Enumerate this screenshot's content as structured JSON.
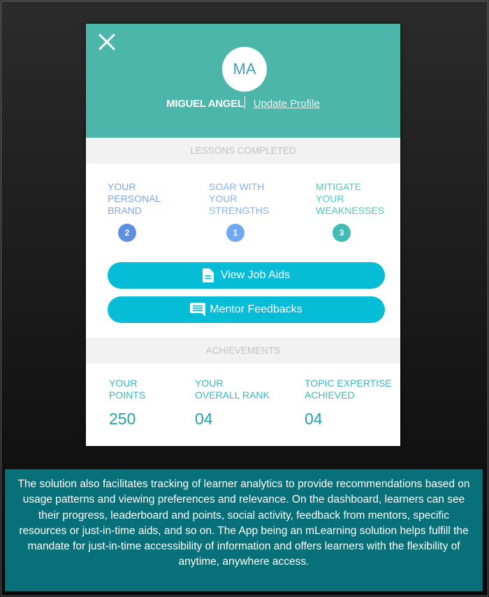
{
  "profile": {
    "initials": "MA",
    "name": "MIGUEL ANGEL",
    "update_link": "Update Profile"
  },
  "lessons": {
    "heading": "LESSONS COMPLETED",
    "items": [
      {
        "title_lines": [
          "YOUR",
          "PERSONAL",
          "BRAND"
        ],
        "count": "2",
        "color": "#5c8fe0"
      },
      {
        "title_lines": [
          "SOAR WITH",
          "YOUR",
          "STRENGTHS"
        ],
        "count": "1",
        "color": "#6fa9f3"
      },
      {
        "title_lines": [
          "MITIGATE",
          "YOUR",
          "WEAKNESSES"
        ],
        "count": "3",
        "color": "#3fbdb4"
      }
    ]
  },
  "actions": {
    "job_aids": {
      "label": "View Job Aids",
      "icon": "document-icon"
    },
    "mentor_feedbacks": {
      "label": "Mentor Feedbacks",
      "icon": "chat-message-icon"
    }
  },
  "achievements": {
    "heading": "ACHIEVEMENTS",
    "items": [
      {
        "label_lines": [
          "YOUR",
          "POINTS"
        ],
        "value": "250"
      },
      {
        "label_lines": [
          "YOUR",
          "OVERALL RANK"
        ],
        "value": "04"
      },
      {
        "label_lines": [
          "TOPIC EXPERTISE",
          "ACHIEVED"
        ],
        "value": "04"
      }
    ]
  },
  "caption": {
    "text": "The solution also facilitates tracking of learner analytics to provide recommendations based on usage patterns and viewing preferences and relevance. On the dashboard, learners can see their progress, leaderboard and points, social activity, feedback from mentors, specific resources or just-in-time aids, and so on. The App being an mLearning solution helps fulfill the mandate for just-in-time accessibility of information and offers learners with the flexibility of anytime, anywhere access."
  },
  "colors": {
    "header": "#4cb6ab",
    "button": "#06bcd6",
    "caption_bg": "#077078"
  }
}
